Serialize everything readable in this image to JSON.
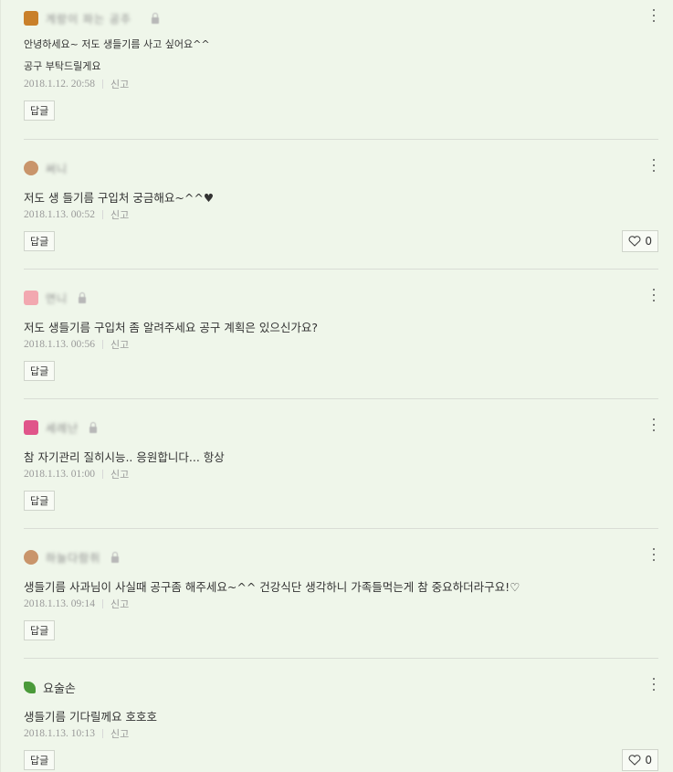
{
  "comments": [
    {
      "nickname": "게랑이 파는 공주",
      "lines": [
        "안녕하세요~ 저도 생들기름 사고 싶어요^^",
        "공구 부탁드릴게요"
      ],
      "date": "2018.1.12. 20:58",
      "report": "신고",
      "reply": "답글",
      "likes": null,
      "avatar_color": "#c9802a"
    },
    {
      "nickname": "써니",
      "lines": [
        "저도 생 들기름 구입처 궁금해요~^^♥"
      ],
      "date": "2018.1.13. 00:52",
      "report": "신고",
      "reply": "답글",
      "likes": "0",
      "avatar_color": "#c9956b"
    },
    {
      "nickname": "연니",
      "lines": [
        "저도 생들기름 구입처 좀 알려주세요 공구 계획은 있으신가요?"
      ],
      "date": "2018.1.13. 00:56",
      "report": "신고",
      "reply": "답글",
      "likes": null,
      "avatar_color": "#f2a8b0"
    },
    {
      "nickname": "세레난",
      "lines": [
        "참 자기관리 질히시능.. 응원합니다... 항상"
      ],
      "date": "2018.1.13. 01:00",
      "report": "신고",
      "reply": "답글",
      "likes": null,
      "avatar_color": "#e0558a"
    },
    {
      "nickname": "하늘다람쥐",
      "lines": [
        "생들기름 사과님이 사실때 공구좀 해주세요~^^ 건강식단 생각하니 가족들먹는게 참 중요하더라구요!♡"
      ],
      "date": "2018.1.13. 09:14",
      "report": "신고",
      "reply": "답글",
      "likes": null,
      "avatar_color": "#c9956b"
    },
    {
      "nickname": "요술손",
      "lines": [
        "생들기름 기다릴께요 호호호"
      ],
      "date": "2018.1.13. 10:13",
      "report": "신고",
      "reply": "답글",
      "likes": "0",
      "avatar_color": "#4a9a3a"
    }
  ]
}
